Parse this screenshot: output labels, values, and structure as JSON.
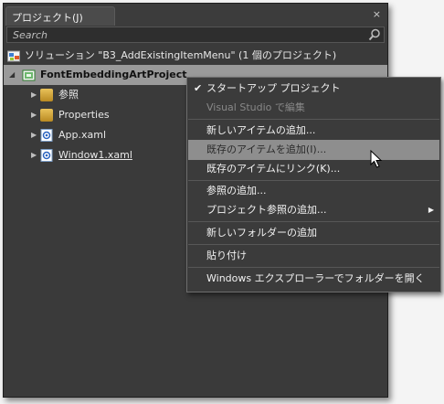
{
  "panel": {
    "tab_title": "プロジェクト(J)",
    "close_glyph": "×",
    "search_placeholder": "Search"
  },
  "tree": {
    "solution_label": "ソリューション \"B3_AddExistingItemMenu\" (1 個のプロジェクト)",
    "project_label": "FontEmbeddingArtProject",
    "items": [
      {
        "label": "参照",
        "icon": "folder-icon"
      },
      {
        "label": "Properties",
        "icon": "folder-icon"
      },
      {
        "label": "App.xaml",
        "icon": "xaml-file-icon"
      },
      {
        "label": "Window1.xaml",
        "icon": "xaml-file-icon"
      }
    ]
  },
  "context_menu": {
    "items": [
      {
        "label": "スタートアップ プロジェクト",
        "checked": true
      },
      {
        "label": "Visual Studio で編集",
        "disabled": true
      },
      {
        "label": "新しいアイテムの追加..."
      },
      {
        "label": "既存のアイテムを追加(I)...",
        "highlighted": true
      },
      {
        "label": "既存のアイテムにリンク(K)..."
      },
      {
        "label": "参照の追加..."
      },
      {
        "label": "プロジェクト参照の追加...",
        "submenu": true
      },
      {
        "label": "新しいフォルダーの追加"
      },
      {
        "label": "貼り付け"
      },
      {
        "label": "Windows エクスプローラーでフォルダーを開く"
      }
    ],
    "check_glyph": "✔",
    "submenu_glyph": "▶"
  },
  "colors": {
    "panel_bg": "#3a3a3a",
    "selection_bg": "#9a9a9a",
    "menu_highlight": "#8e8e8e"
  }
}
